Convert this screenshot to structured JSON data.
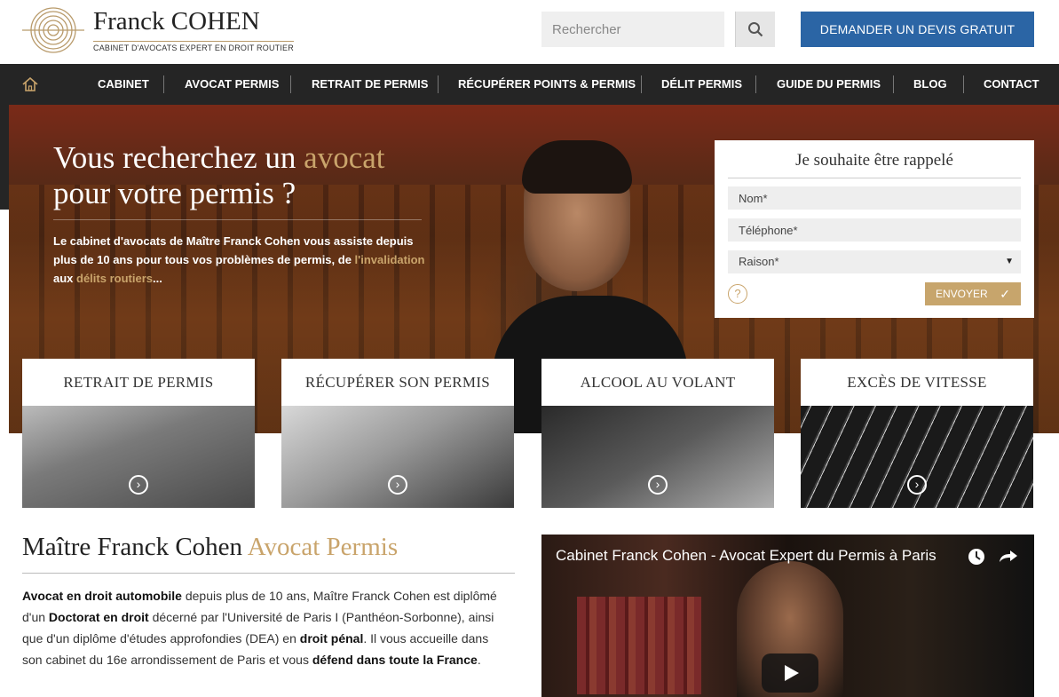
{
  "header": {
    "logo_name": "Franck COHEN",
    "logo_tagline": "CABINET D'AVOCATS EXPERT EN DROIT ROUTIER",
    "search_placeholder": "Rechercher",
    "cta_label": "DEMANDER UN DEVIS GRATUIT"
  },
  "nav": {
    "items": [
      "CABINET",
      "AVOCAT PERMIS",
      "RETRAIT DE PERMIS",
      "RÉCUPÉRER POINTS & PERMIS",
      "DÉLIT PERMIS",
      "GUIDE DU PERMIS",
      "BLOG",
      "CONTACT"
    ]
  },
  "hero": {
    "title_part1": "Vous recherchez un ",
    "title_highlight": "avocat",
    "title_part2": "pour votre permis ?",
    "text_a": "Le cabinet d'avocats de ",
    "text_name": "Maître Franck Cohen",
    "text_b": " vous assiste depuis plus de 10 ans pour tous vos problèmes de permis, de ",
    "link1": "l'invalidation",
    "text_c": " aux ",
    "link2": "délits routiers",
    "text_d": "..."
  },
  "callback_form": {
    "title": "Je souhaite être rappelé",
    "name_placeholder": "Nom*",
    "phone_placeholder": "Téléphone*",
    "reason_value": "Raison*",
    "help_symbol": "?",
    "submit_label": "ENVOYER"
  },
  "cards": [
    {
      "title": "RETRAIT DE PERMIS"
    },
    {
      "title": "RÉCUPÉRER SON PERMIS"
    },
    {
      "title": "ALCOOL AU VOLANT"
    },
    {
      "title": "EXCÈS DE VITESSE"
    }
  ],
  "intro": {
    "title_main": "Maître Franck Cohen ",
    "title_highlight": "Avocat Permis",
    "p1": "Avocat en droit automobile",
    "p2": " depuis plus de 10 ans, Maître Franck Cohen est diplômé d'un ",
    "p3": "Doctorat en droit",
    "p4": " décerné par l'Université de Paris I (Panthéon-Sorbonne), ainsi que d'un diplôme d'études approfondies (DEA) en ",
    "p5": "droit pénal",
    "p6": ". Il vous accueille dans son cabinet du 16e arrondissement de Paris et vous ",
    "p7": "défend dans toute la France",
    "p8": "."
  },
  "video": {
    "title": "Cabinet Franck Cohen - Avocat Expert du Permis à Paris"
  },
  "colors": {
    "accent_gold": "#c9a46b",
    "cta_blue": "#2b65a5",
    "nav_dark": "#252525"
  },
  "icons": [
    "home-icon",
    "search-icon",
    "help-icon",
    "check-icon",
    "arrow-right-circle-icon",
    "clock-icon",
    "share-icon",
    "play-icon"
  ]
}
